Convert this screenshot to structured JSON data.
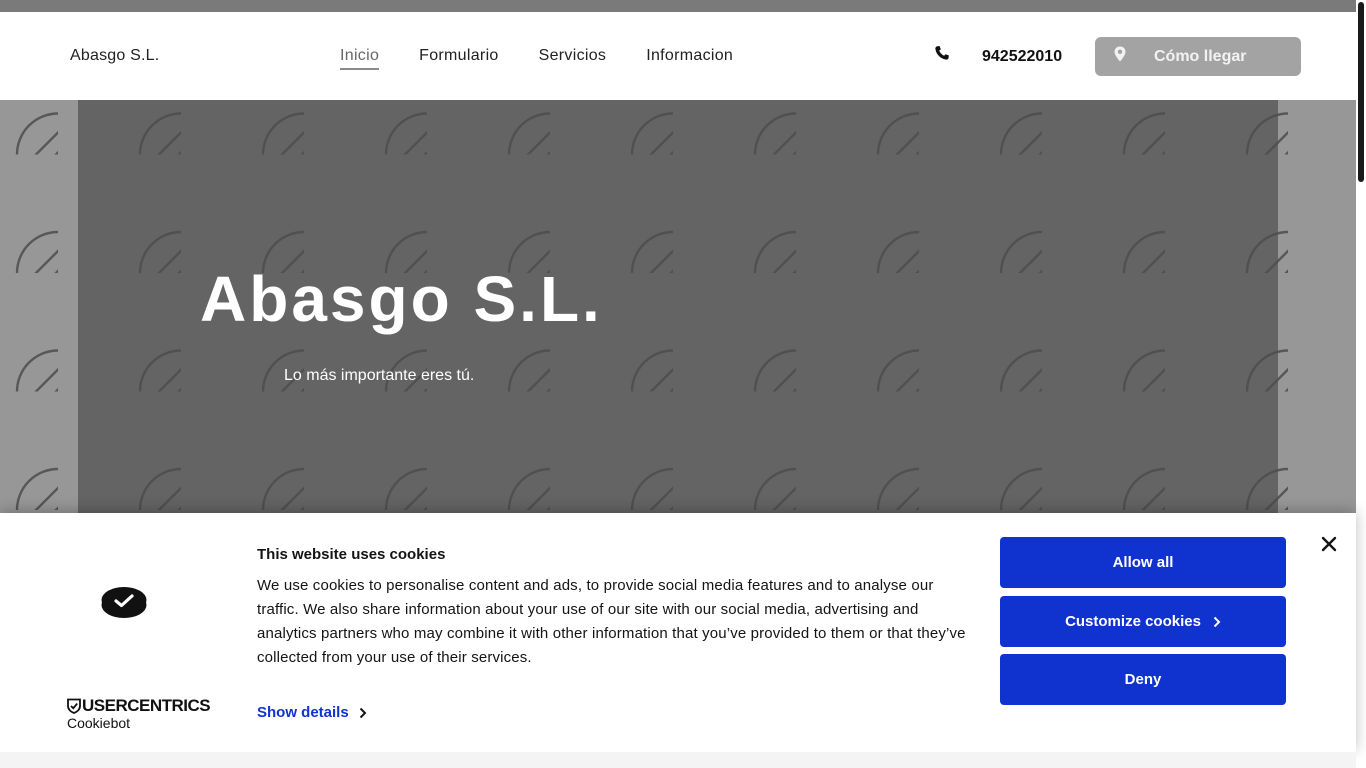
{
  "header": {
    "brand": "Abasgo S.L.",
    "nav": [
      {
        "label": "Inicio",
        "active": true
      },
      {
        "label": "Formulario",
        "active": false
      },
      {
        "label": "Servicios",
        "active": false
      },
      {
        "label": "Informacion",
        "active": false
      }
    ],
    "phone": "942522010",
    "phone_icon": "phone-icon",
    "directions_label": "Cómo llegar",
    "directions_icon": "map-pin-icon"
  },
  "hero": {
    "title": "Abasgo S.L.",
    "subtitle": "Lo más importante eres tú.",
    "pattern_icon": "price-tag-icon"
  },
  "cookie_banner": {
    "brand_top": "USERCENTRICS",
    "brand_bottom": "Cookiebot",
    "title": "This website uses cookies",
    "text": "We use cookies to personalise content and ads, to provide social media features and to analyse our traffic. We also share information about your use of our site with our social media, advertising and analytics partners who may combine it with other information that you’ve provided to them or that they’ve collected from your use of their services.",
    "show_details": "Show details",
    "allow_all": "Allow all",
    "customize": "Customize cookies",
    "deny": "Deny"
  },
  "colors": {
    "cookie_primary": "#1032cf",
    "hero_dark": "#646464",
    "hero_light": "#979797",
    "directions_button": "#a3a3a3"
  }
}
